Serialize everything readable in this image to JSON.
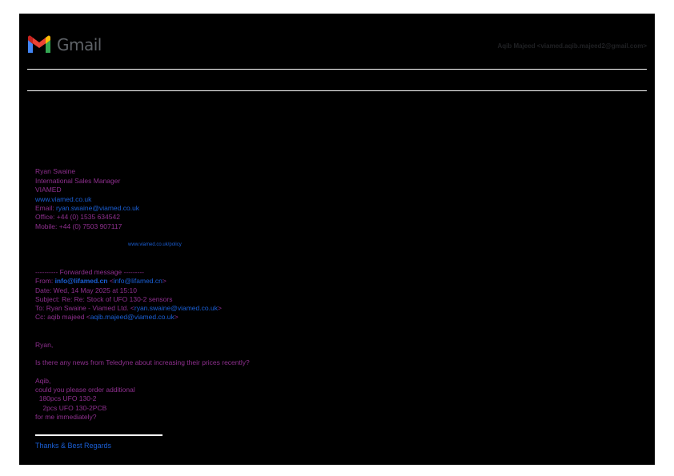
{
  "header": {
    "app_name": "Gmail",
    "account": "Aqib Majeed <viamed.aqib.majeed2@gmail.com>"
  },
  "signature": {
    "name": "Ryan Swaine",
    "title": "International Sales Manager",
    "company": "VIAMED",
    "website": "www.viamed.co.uk",
    "email_label": "Email: ",
    "email": "ryan.swaine@viamed.co.uk",
    "office": "Office: +44 (0) 1535 634542",
    "mobile": "Mobile: +44 (0) 7503 907117",
    "policy_link": "www.viamed.co.uk/policy"
  },
  "forwarded": {
    "divider": "---------- Forwarded message ---------",
    "from_label": "From: ",
    "from_name": "info@lifamed.cn",
    "from_addr_open": " <",
    "from_addr": "info@lifamed.cn",
    "from_addr_close": ">",
    "date": "Date: Wed, 14 May 2025 at 15:10",
    "subject": "Subject: Re: Re: Stock of UFO 130-2 sensors",
    "to_label": "To: Ryan Swaine - Viamed Ltd. <",
    "to_addr": "ryan.swaine@viamed.co.uk",
    "to_close": ">",
    "cc_label": "Cc: aqib majeed <",
    "cc_addr": "aqib.majeed@viamed.co.uk",
    "cc_close": ">"
  },
  "body": {
    "greeting": "Ryan,",
    "question": "Is there any news from Teledyne about increasing their prices recently?",
    "aqib": "Aqib,",
    "request": "could you please order additional",
    "item1": "  180pcs UFO 130-2",
    "item2": "    2pcs UFO 130-2PCB",
    "closing": "for me immediately?",
    "regards": "Thanks & Best Regards"
  },
  "colors": {
    "page_background": "#000000",
    "text": "#8e2f8e",
    "link": "#1a5fd6"
  }
}
